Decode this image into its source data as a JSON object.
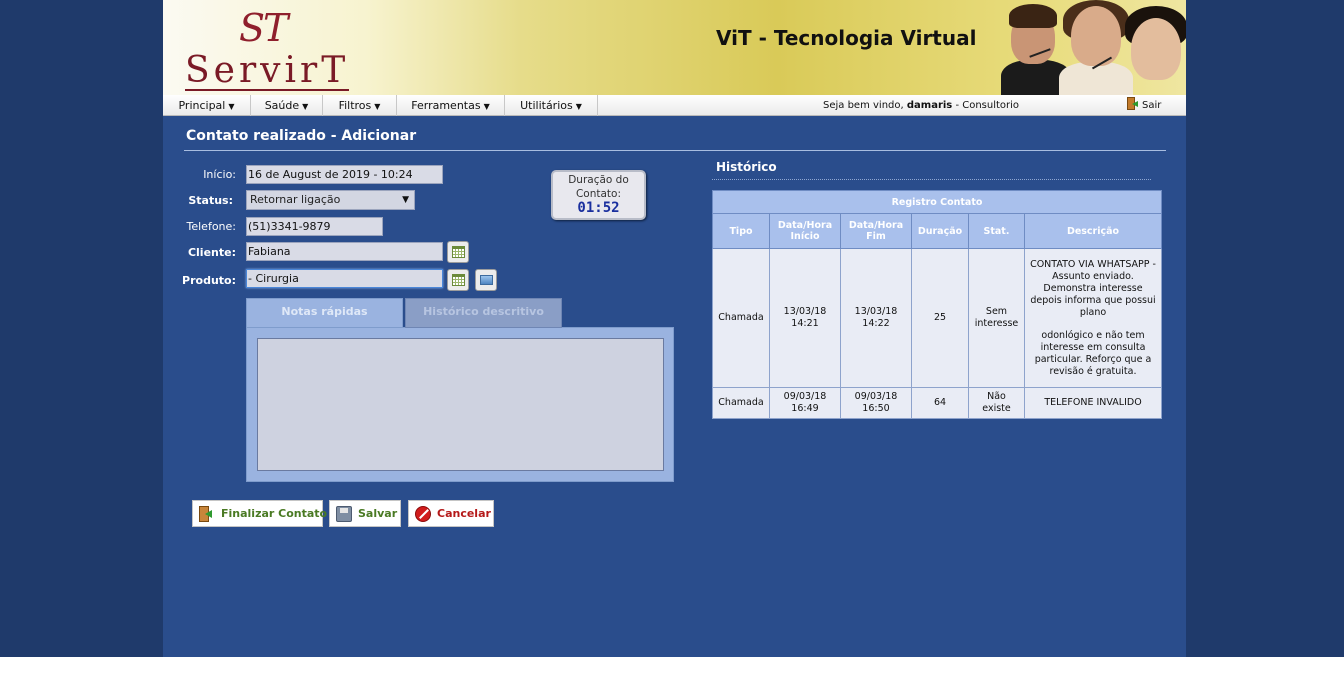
{
  "brand": {
    "logo_top": "ST",
    "logo_name": "ServirT",
    "title": "ViT - Tecnologia Virtual"
  },
  "menu": {
    "items": [
      {
        "label": "Principal"
      },
      {
        "label": "Saúde"
      },
      {
        "label": "Filtros"
      },
      {
        "label": "Ferramentas"
      },
      {
        "label": "Utilitários"
      }
    ],
    "welcome_prefix": "Seja bem vindo,",
    "user": "damaris",
    "context": " - Consultorio",
    "exit_label": "Sair"
  },
  "page": {
    "title": "Contato realizado - Adicionar"
  },
  "form": {
    "inicio_label": "Início:",
    "inicio_value": "16 de August de 2019 - 10:24",
    "status_label": "Status:",
    "status_value": "Retornar ligação",
    "telefone_label": "Telefone:",
    "telefone_value": "(51)3341-9879",
    "cliente_label": "Cliente:",
    "cliente_value": "Fabiana",
    "produto_label": "Produto:",
    "produto_value": "- Cirurgia"
  },
  "duration": {
    "label_line1": "Duração do",
    "label_line2": "Contato:",
    "value": "01:52"
  },
  "tabs": {
    "notes_label": "Notas rápidas",
    "history_label": "Histórico descritivo",
    "notes_value": ""
  },
  "actions": {
    "finalize": "Finalizar Contato",
    "save": "Salvar",
    "cancel": "Cancelar"
  },
  "history": {
    "title": "Histórico",
    "caption": "Registro Contato",
    "columns": [
      "Tipo",
      "Data/Hora Início",
      "Data/Hora Fim",
      "Duração",
      "Stat.",
      "Descrição"
    ],
    "rows": [
      {
        "tipo": "Chamada",
        "inicio_date": "13/03/18",
        "inicio_time": "14:21",
        "fim_date": "13/03/18",
        "fim_time": "14:22",
        "duracao": "25",
        "stat_l1": "Sem",
        "stat_l2": "interesse",
        "descricao_p1": "CONTATO VIA WHATSAPP - Assunto enviado. Demonstra interesse depois informa que possui plano",
        "descricao_p2": "odonlógico e não tem interesse em consulta particular. Reforço que a revisão é gratuita."
      },
      {
        "tipo": "Chamada",
        "inicio_date": "09/03/18",
        "inicio_time": "16:49",
        "fim_date": "09/03/18",
        "fim_time": "16:50",
        "duracao": "64",
        "stat_l1": "Não",
        "stat_l2": "existe",
        "descricao_p1": "TELEFONE INVALIDO",
        "descricao_p2": ""
      }
    ]
  },
  "colors": {
    "page_bg": "#1f3a6b",
    "app_bg": "#2a4d8c",
    "table_header": "#a9c0ec",
    "duration_value": "#1a2f9e"
  }
}
